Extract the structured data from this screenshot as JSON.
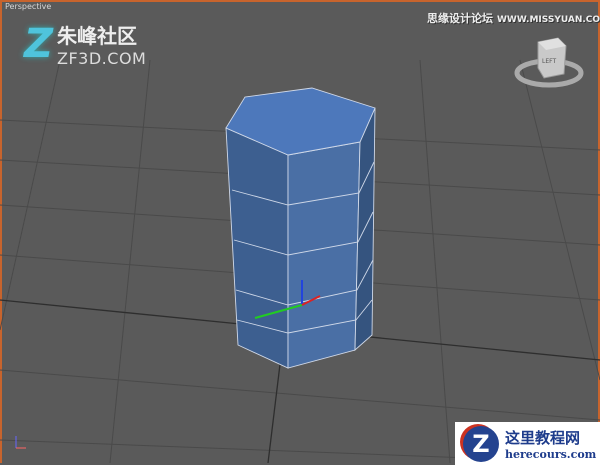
{
  "viewport": {
    "label": "Perspective",
    "border_color": "#c8642d",
    "object_color": "#4a6fa5"
  },
  "watermarks": {
    "logo_mark": "Z",
    "logo_cn": "朱峰社区",
    "logo_en": "ZF3D.COM",
    "forum_cn": "思缘设计论坛",
    "forum_url": "WWW.MISSYUAN.COM",
    "bottom_mark": "Z",
    "bottom_cn": "这里教程网",
    "bottom_url": "herecours.com"
  },
  "viewcube": {
    "face_label": "LEFT"
  }
}
